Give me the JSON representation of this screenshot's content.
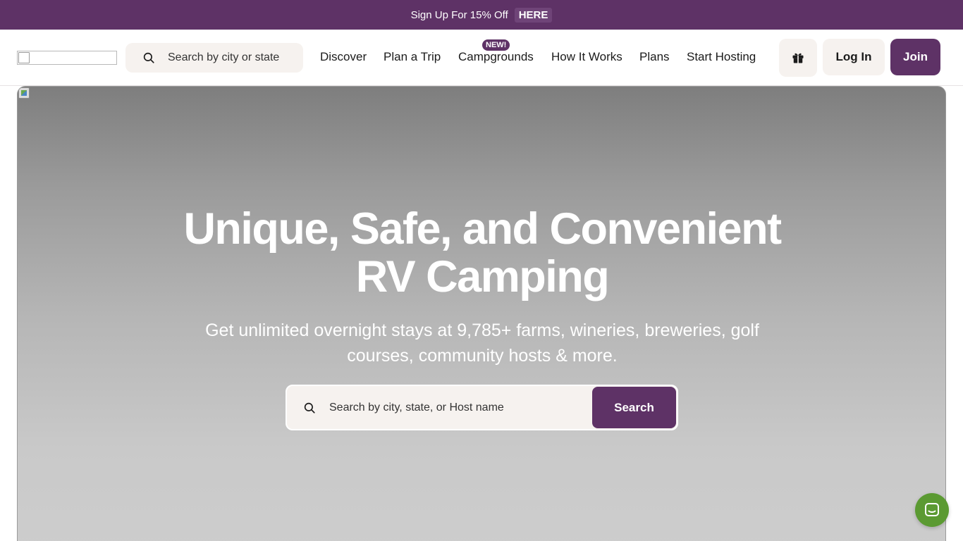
{
  "promo": {
    "text": "Sign Up For 15% Off",
    "link_label": "HERE"
  },
  "header": {
    "search_placeholder": "Search by city or state",
    "nav": {
      "discover": "Discover",
      "plan_a_trip": "Plan a Trip",
      "campgrounds": "Campgrounds",
      "campgrounds_badge": "NEW!",
      "how_it_works": "How It Works",
      "plans": "Plans",
      "start_hosting": "Start Hosting"
    },
    "gift_icon": "gift-icon",
    "login_label": "Log In",
    "join_label": "Join"
  },
  "hero": {
    "title_line1": "Unique, Safe, and Convenient",
    "title_line2": "RV Camping",
    "subtitle": "Get unlimited overnight stays at 9,785+ farms, wineries, breweries, golf courses, community hosts & more.",
    "search_placeholder": "Search by city, state, or Host name",
    "search_button": "Search"
  },
  "chat": {
    "icon": "chat-icon"
  },
  "colors": {
    "brand_purple": "#5e3266",
    "chat_green": "#5b9a32",
    "button_bg": "#f6f2ef"
  }
}
